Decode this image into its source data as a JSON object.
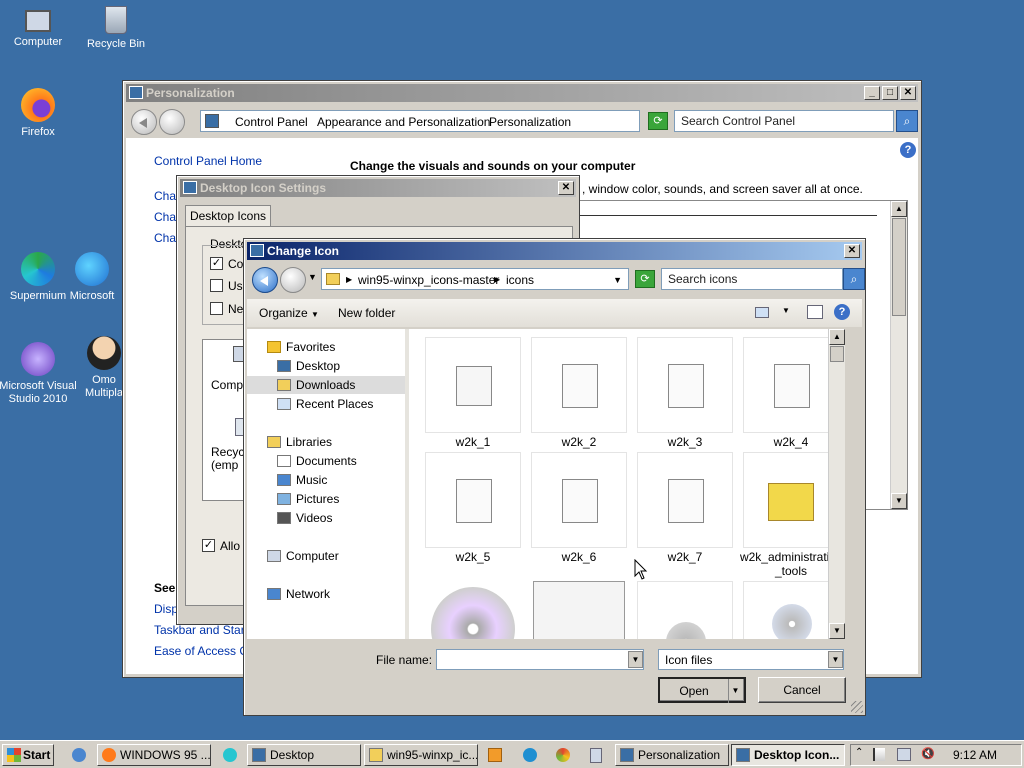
{
  "desktop": {
    "icons": [
      {
        "label": "Computer"
      },
      {
        "label": "Recycle Bin"
      },
      {
        "label": "Firefox"
      },
      {
        "label": "Supermium"
      },
      {
        "label": "Microsoft"
      },
      {
        "label": "Microsoft Visual Studio 2010"
      },
      {
        "label": "Omo Multipla"
      }
    ]
  },
  "personalization": {
    "title": "Personalization",
    "breadcrumb": [
      "Control Panel",
      "Appearance and Personalization",
      "Personalization"
    ],
    "search_placeholder": "Search Control Panel",
    "home_link": "Control Panel Home",
    "heading": "Change the visuals and sounds on your computer",
    "desc_partial": ", window color, sounds, and screen saver all at once.",
    "side_links": [
      "Char",
      "Char",
      "Char"
    ],
    "see_also": "See",
    "bottom_links": [
      "Displ",
      "Taskbar and Start",
      "Ease of Access Ce"
    ]
  },
  "desktop_icon_settings": {
    "title": "Desktop Icon Settings",
    "tab": "Desktop Icons",
    "group_label": "Deskto",
    "checks": [
      "Co",
      "Us",
      "Ne"
    ],
    "preview_labels": [
      "Comp",
      "Recyc (emp"
    ],
    "allow_label": "Allo"
  },
  "change_icon": {
    "title": "Change Icon",
    "path": [
      "win95-winxp_icons-master",
      "icons"
    ],
    "search_placeholder": "Search icons",
    "toolbar": {
      "organize": "Organize",
      "new_folder": "New folder"
    },
    "nav": {
      "favorites": "Favorites",
      "fav_items": [
        "Desktop",
        "Downloads",
        "Recent Places"
      ],
      "libraries": "Libraries",
      "lib_items": [
        "Documents",
        "Music",
        "Pictures",
        "Videos"
      ],
      "computer": "Computer",
      "network": "Network"
    },
    "files": [
      "w2k_1",
      "w2k_2",
      "w2k_3",
      "w2k_4",
      "w2k_5",
      "w2k_6",
      "w2k_7",
      "w2k_administrative _tools"
    ],
    "file_name_label": "File name:",
    "file_name_value": "",
    "file_type": "Icon files",
    "open_label": "Open",
    "cancel_label": "Cancel"
  },
  "taskbar": {
    "start": "Start",
    "tasks": [
      "WINDOWS 95 ...",
      "Desktop",
      "win95-winxp_ic...",
      "Personalization",
      "Desktop Icon..."
    ],
    "clock": "9:12 AM"
  }
}
